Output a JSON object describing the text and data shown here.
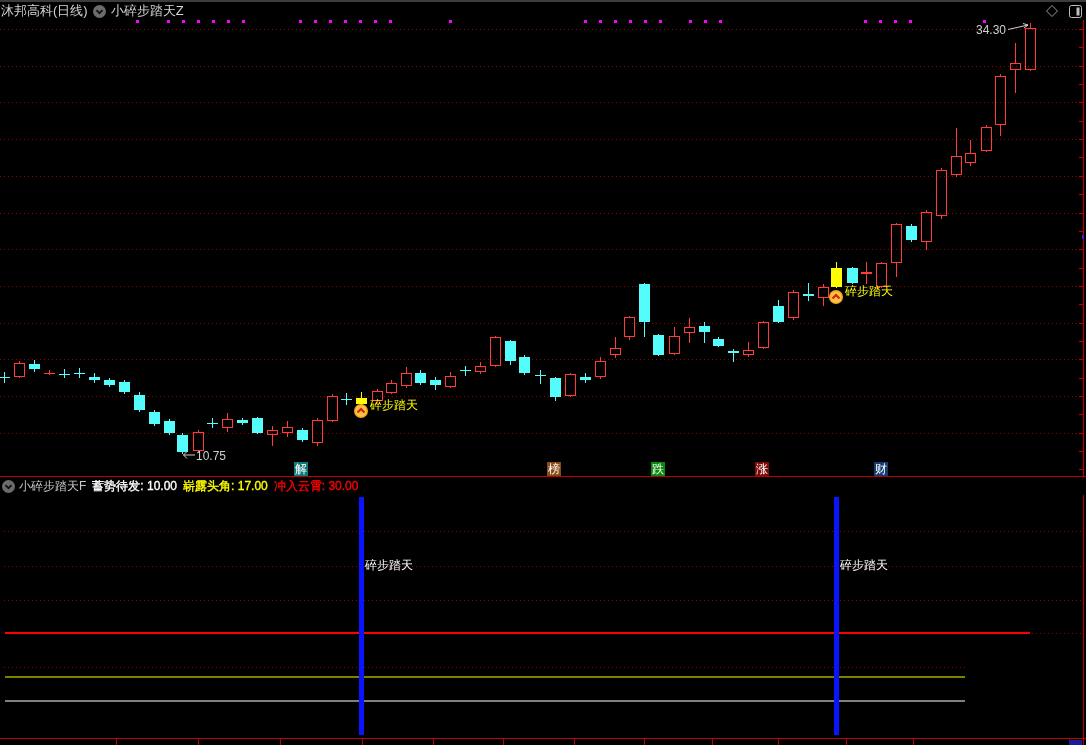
{
  "header": {
    "title": "沐邦高科(日线)",
    "indicator": "小碎步踏天Z"
  },
  "main_chart": {
    "high_label": "34.30",
    "low_label": "10.75",
    "signals": [
      {
        "label": "碎步踏天"
      },
      {
        "label": "碎步踏天"
      }
    ],
    "markers": [
      {
        "label": "解",
        "color": "#0e7a78"
      },
      {
        "label": "榜",
        "color": "#8a4a14"
      },
      {
        "label": "跌",
        "color": "#0a8a0a"
      },
      {
        "label": "涨",
        "color": "#800a0a"
      },
      {
        "label": "财",
        "color": "#143c70"
      }
    ]
  },
  "indicator_panel": {
    "name": "小碎步踏天F",
    "levels": [
      {
        "label": "蓄势待发: 10.00",
        "color": "#ffffff"
      },
      {
        "label": "崭露头角: 17.00",
        "color": "#ffff00"
      },
      {
        "label": "冲入云霄: 30.00",
        "color": "#ff0000"
      }
    ],
    "signals": [
      {
        "label": "碎步踏天"
      },
      {
        "label": "碎步踏天"
      }
    ]
  }
}
